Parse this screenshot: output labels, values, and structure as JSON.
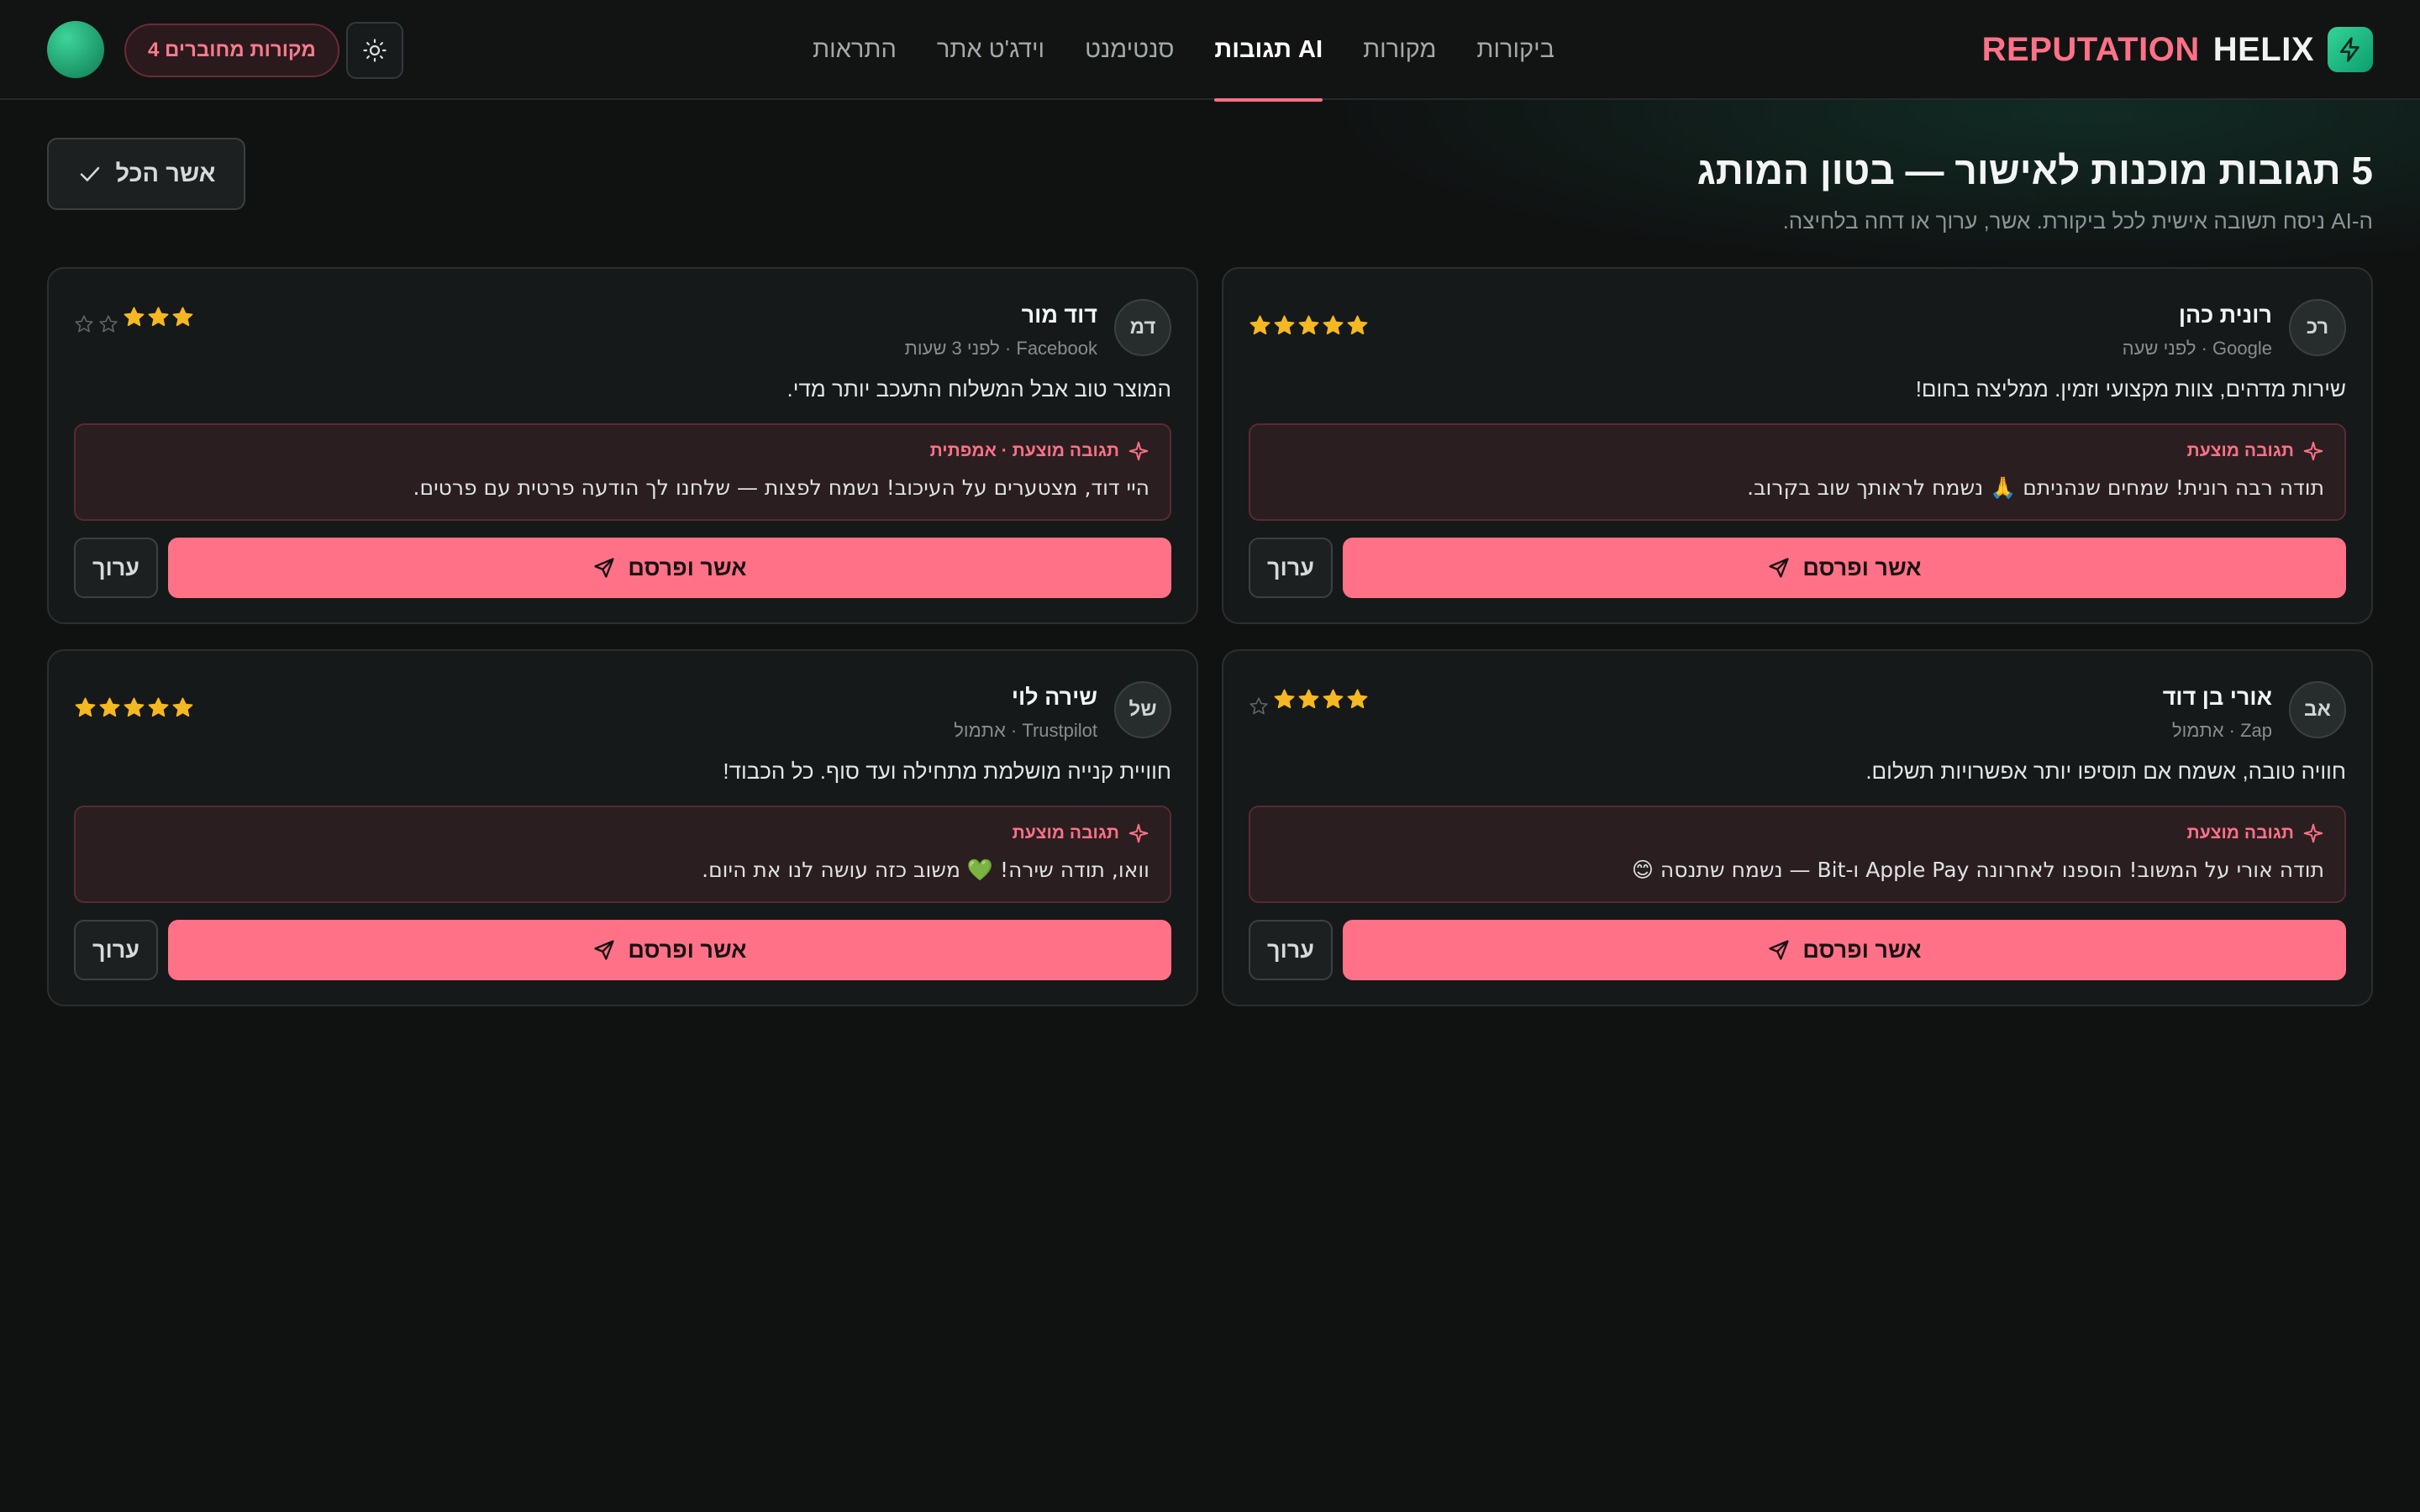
{
  "brand": {
    "word1": "REPUTATION",
    "word2": "HELIX",
    "icon": "bolt-icon"
  },
  "nav": {
    "items": [
      {
        "label": "ביקורות",
        "active": false
      },
      {
        "label": "מקורות",
        "active": false
      },
      {
        "label": "תגובות AI",
        "active": true
      },
      {
        "label": "סנטימנט",
        "active": false
      },
      {
        "label": "וידג'ט אתר",
        "active": false
      },
      {
        "label": "התראות",
        "active": false
      }
    ]
  },
  "header_actions": {
    "sources_badge": "4 מקורות מחוברים",
    "theme_icon": "sun-icon"
  },
  "main": {
    "title": "5 תגובות מוכנות לאישור — בטון המותג",
    "subtitle": "ה-AI ניסח תשובה אישית לכל ביקורת. אשר, ערוך או דחה בלחיצה.",
    "approve_all_label": "אשר הכל"
  },
  "cards": [
    {
      "initials": "רכ",
      "name": "רונית כהן",
      "meta": "Google · לפני שעה",
      "rating": 5,
      "review": "שירות מדהים, צוות מקצועי וזמין. ממליצה בחום!",
      "suggest_label": "תגובה מוצעת",
      "suggest_text": "תודה רבה רונית! שמחים שנהניתם 🙏 נשמח לראותך שוב בקרוב.",
      "approve_label": "אשר ופרסם",
      "edit_label": "ערוך"
    },
    {
      "initials": "דמ",
      "name": "דוד מור",
      "meta": "Facebook · לפני 3 שעות",
      "rating": 3,
      "review": "המוצר טוב אבל המשלוח התעכב יותר מדי.",
      "suggest_label": "תגובה מוצעת · אמפתית",
      "suggest_text": "היי דוד, מצטערים על העיכוב! נשמח לפצות — שלחנו לך הודעה פרטית עם פרטים.",
      "approve_label": "אשר ופרסם",
      "edit_label": "ערוך"
    },
    {
      "initials": "אב",
      "name": "אורי בן דוד",
      "meta": "Zap · אתמול",
      "rating": 4,
      "review": "חוויה טובה, אשמח אם תוסיפו יותר אפשרויות תשלום.",
      "suggest_label": "תגובה מוצעת",
      "suggest_text": "תודה אורי על המשוב! הוספנו לאחרונה Apple Pay ו-Bit — נשמח שתנסה 😊",
      "approve_label": "אשר ופרסם",
      "edit_label": "ערוך"
    },
    {
      "initials": "של",
      "name": "שירה לוי",
      "meta": "Trustpilot · אתמול",
      "rating": 5,
      "review": "חוויית קנייה מושלמת מתחילה ועד סוף. כל הכבוד!",
      "suggest_label": "תגובה מוצעת",
      "suggest_text": "וואו, תודה שירה! 💚 משוב כזה עושה לנו את היום.",
      "approve_label": "אשר ופרסם",
      "edit_label": "ערוך"
    }
  ],
  "colors": {
    "accent": "#ff7187",
    "brand_green": "#22c58b",
    "star": "#f5b820",
    "bg": "#101212"
  }
}
